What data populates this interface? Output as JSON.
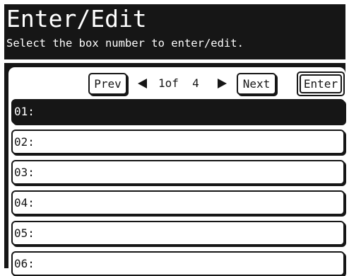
{
  "header": {
    "title": "Enter/Edit",
    "subtitle": "Select the box number to enter/edit."
  },
  "nav": {
    "prev_label": "Prev",
    "next_label": "Next",
    "enter_label": "Enter",
    "page_text": "1of  4",
    "current_page": 1,
    "total_pages": 4
  },
  "boxes": [
    {
      "label": "01:",
      "selected": true
    },
    {
      "label": "02:",
      "selected": false
    },
    {
      "label": "03:",
      "selected": false
    },
    {
      "label": "04:",
      "selected": false
    },
    {
      "label": "05:",
      "selected": false
    },
    {
      "label": "06:",
      "selected": false
    }
  ],
  "colors": {
    "foreground": "#161616",
    "background": "#ffffff"
  }
}
